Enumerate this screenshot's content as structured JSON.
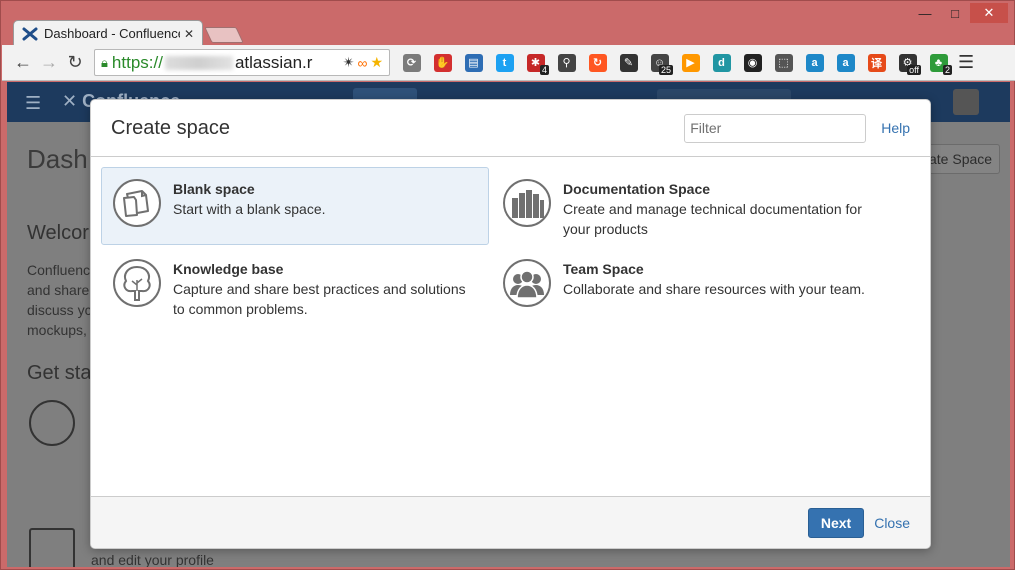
{
  "browser": {
    "tab_title": "Dashboard - Confluence",
    "url_scheme": "https://",
    "url_host": "atlassian.r",
    "window_controls": {
      "minimize": "—",
      "maximize": "□",
      "close": "✕"
    },
    "extensions": [
      {
        "name": "refresh-ext-icon",
        "glyph": "⟳",
        "color": "#7b7b7b",
        "badge": ""
      },
      {
        "name": "adblock-icon",
        "glyph": "✋",
        "color": "#d32f2f",
        "badge": ""
      },
      {
        "name": "print-icon",
        "glyph": "▤",
        "color": "#2e6db4",
        "badge": ""
      },
      {
        "name": "twitter-icon",
        "glyph": "t",
        "color": "#1da1f2",
        "badge": ""
      },
      {
        "name": "lastpass-icon",
        "glyph": "✱",
        "color": "#c62828",
        "badge": "4"
      },
      {
        "name": "feather-icon",
        "glyph": "⚲",
        "color": "#444444",
        "badge": ""
      },
      {
        "name": "sync-icon",
        "glyph": "↻",
        "color": "#ff5722",
        "badge": ""
      },
      {
        "name": "edit-icon",
        "glyph": "✎",
        "color": "#333333",
        "badge": ""
      },
      {
        "name": "tracker-icon",
        "glyph": "☺",
        "color": "#444444",
        "badge": "25"
      },
      {
        "name": "play-icon",
        "glyph": "▶",
        "color": "#ff9800",
        "badge": ""
      },
      {
        "name": "dict-icon",
        "glyph": "d",
        "color": "#2196a3",
        "badge": ""
      },
      {
        "name": "color-picker-icon",
        "glyph": "◉",
        "color": "#222222",
        "badge": ""
      },
      {
        "name": "screenshot-icon",
        "glyph": "⬚",
        "color": "#555555",
        "badge": ""
      },
      {
        "name": "text-a-icon",
        "glyph": "a",
        "color": "#1e88c8",
        "badge": ""
      },
      {
        "name": "text-a2-icon",
        "glyph": "a",
        "color": "#1e88c8",
        "badge": ""
      },
      {
        "name": "translate-icon",
        "glyph": "译",
        "color": "#e64a19",
        "badge": ""
      },
      {
        "name": "bug-off-icon",
        "glyph": "⚙",
        "color": "#333333",
        "badge": "off"
      },
      {
        "name": "leaf-icon",
        "glyph": "♣",
        "color": "#2e9b3a",
        "badge": "2"
      }
    ]
  },
  "background": {
    "page_title": "Dash",
    "create_space_button": "ate Space",
    "welcome_heading": "Welcor",
    "welcome_body": "Confluenc and share discuss yc mockups,",
    "get_started": "Get sta",
    "profile_text": "and edit your profile"
  },
  "modal": {
    "title": "Create space",
    "filter_placeholder": "Filter",
    "help_label": "Help",
    "templates": [
      {
        "name": "Blank space",
        "desc": "Start with a blank space.",
        "icon": "blank-page-icon",
        "selected": true
      },
      {
        "name": "Documentation Space",
        "desc": "Create and manage technical documentation for your products",
        "icon": "books-icon",
        "selected": false
      },
      {
        "name": "Knowledge base",
        "desc": "Capture and share best practices and solutions to common problems.",
        "icon": "tree-icon",
        "selected": false
      },
      {
        "name": "Team Space",
        "desc": "Collaborate and share resources with your team.",
        "icon": "team-icon",
        "selected": false
      }
    ],
    "next_label": "Next",
    "close_label": "Close"
  },
  "colors": {
    "primary": "#3572b0",
    "selected_bg": "#ebf2f9",
    "header_bg": "#1d3a5e",
    "window_frame": "#cb6a6a"
  }
}
